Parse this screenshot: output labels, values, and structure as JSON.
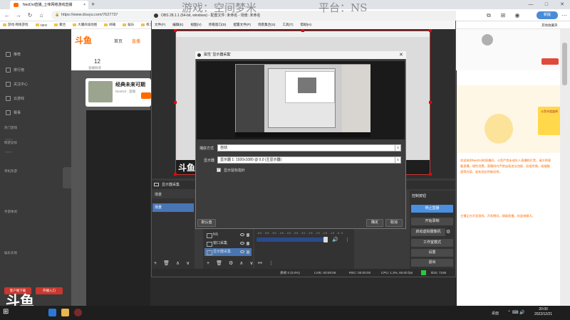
{
  "browser": {
    "tab_title": "NeoDol直播_土味网络游戏直播",
    "new_tab": "+",
    "url": "https://www.douyu.com/7627737",
    "new_tab_button": "新版",
    "bookmarks": [
      "游戏-网络游戏",
      "NEO",
      "聚合",
      "大疆商城地图",
      "邮箱",
      "娱乐",
      "练习"
    ],
    "bookmark_right": "其他收藏夹",
    "controls": [
      "—",
      "□",
      "✕"
    ]
  },
  "site": {
    "logo": "斗鱼",
    "nav": [
      "首页",
      "直播"
    ],
    "stats": [
      {
        "value": "12",
        "label": "直播频道"
      }
    ],
    "recommend_title": "经典未来可期",
    "recommend_sub": "NeoDol · 直播",
    "sidebar_items": [
      "推荐",
      "排行榜",
      "关注中心",
      "云游戏",
      "赛事"
    ],
    "sidebar_groups": [
      "热门游戏",
      "网游竞技",
      "单机热游",
      "手游休闲",
      "娱乐天地"
    ],
    "sidebar_bottom_buttons": [
      "客户端下载",
      "开播入口"
    ],
    "chat_text": "欢迎来到NeoDol的直播间，斗鱼严禁未成年人直播和打赏，请文明观看直播，理性消费。直播间内严禁出现违法违规、低俗色情、吸烟酗酒等内容，若有违反将被封停。",
    "chat_text2": "主播正在开发游戏，开发期间，随缘直播，欢迎来聊天。",
    "gift_ad": "斗鱼年度盛典"
  },
  "overlay": {
    "game": "游戏：空间梦米",
    "platform": "平台：NS"
  },
  "obs": {
    "title": "OBS 28.1.1 (64-bit, windows) - 配置文件: 未命名 - 场景: 未命名",
    "menu": [
      "文件(F)",
      "编辑(E)",
      "视图(V)",
      "停靠窗口(D)",
      "配置文件(P)",
      "场景集合(S)",
      "工具(T)",
      "帮助(H)"
    ],
    "source_bar": "显示器采集",
    "scenes_header": "场景",
    "scene_item": "场景",
    "sources": [
      {
        "name": "NS",
        "selected": false
      },
      {
        "name": "窗口采集",
        "selected": false
      },
      {
        "name": "显示器采集",
        "selected": true
      }
    ],
    "mixer_ticks": "-60 -55 -50 -45 -40 -35 -30 -25 -20 -15 -10 -5 0",
    "controls_header": "控制按钮",
    "controls": [
      "停止直播",
      "开始录制",
      "启动虚拟摄像机",
      "工作室模式",
      "设置",
      "退出"
    ],
    "status": {
      "dropped": "丢帧 0 (0.0%)",
      "live": "LIVE: 00:00:06",
      "rec": "REC: 00:00:00",
      "cpu": "CPU: 1.3%, 60.00 fps",
      "bitrate": "kb/s: 7185"
    },
    "brand_watermark": "斗鱼",
    "dock_footer": [
      "+",
      "🗑",
      "∧",
      "∨"
    ]
  },
  "dialog": {
    "title": "属性 '显示器采集'",
    "capture_method_label": "捕获方式",
    "capture_method_value": "自动",
    "display_label": "显示器",
    "display_value": "显示器 1: 1920x1080 @ 0,0 (主显示器)",
    "cursor_label": "显示鼠标指针",
    "cursor_checked": "✓",
    "defaults_button": "默认值",
    "ok_button": "确定",
    "cancel_button": "取消"
  },
  "taskbar": {
    "desktop": "桌面",
    "time": "20:00",
    "date": "2022/12/21"
  },
  "colors": {
    "accent": "#ff6a00",
    "obs_selection": "#4876b5",
    "stream_button": "#4a8fe0",
    "record_indicator": "#28c840"
  }
}
